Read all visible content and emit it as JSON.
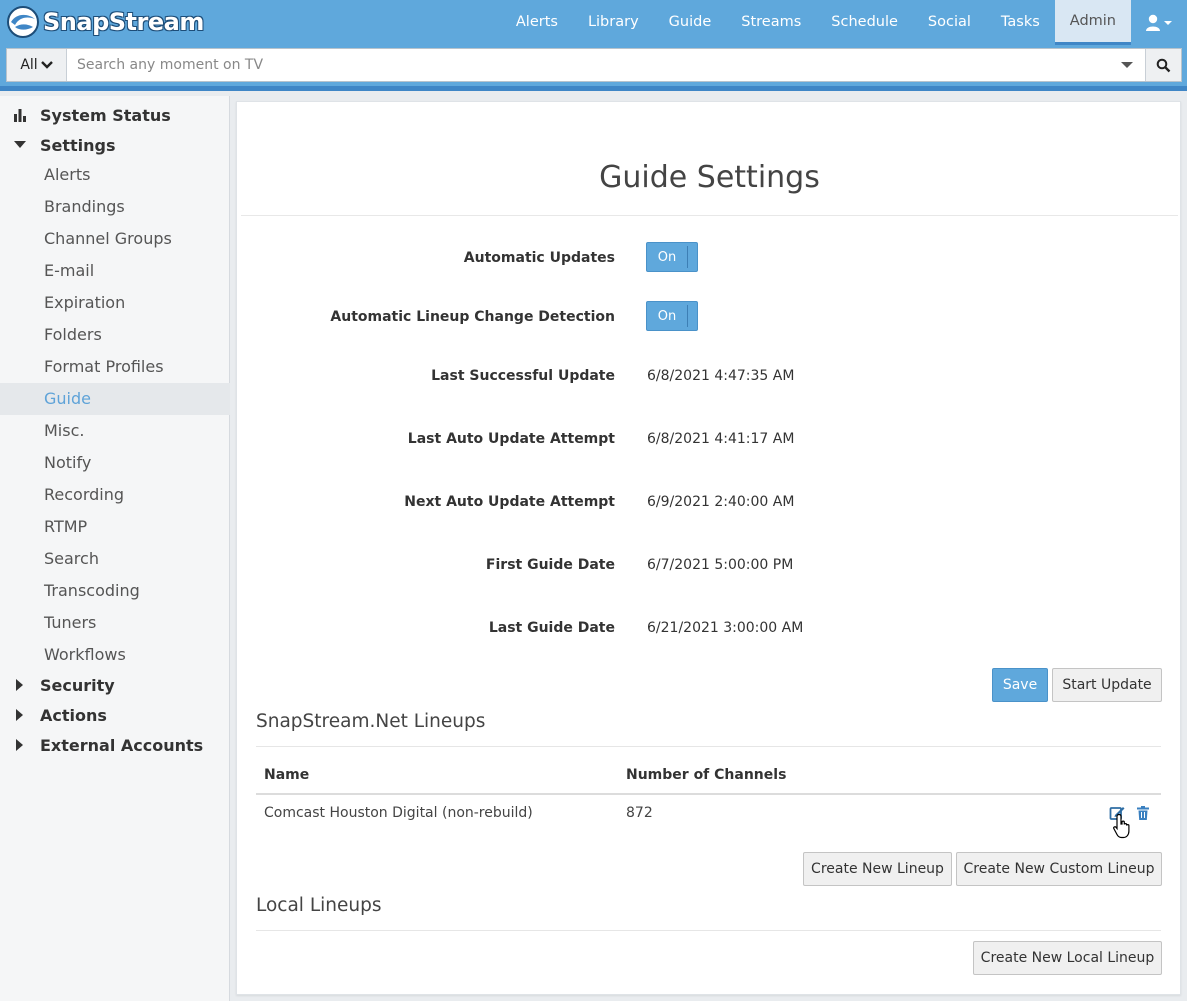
{
  "app": {
    "logo_text": "SnapStream",
    "nav": [
      "Alerts",
      "Library",
      "Guide",
      "Streams",
      "Schedule",
      "Social",
      "Tasks",
      "Admin"
    ],
    "active_nav": "Admin"
  },
  "search": {
    "scope": "All",
    "placeholder": "Search any moment on TV"
  },
  "sidebar": {
    "sections": [
      {
        "label": "System Status",
        "icon": "bar-chart-icon"
      },
      {
        "label": "Settings",
        "icon": "caret-down-icon"
      },
      {
        "label": "Security",
        "icon": "caret-right-icon"
      },
      {
        "label": "Actions",
        "icon": "caret-right-icon"
      },
      {
        "label": "External Accounts",
        "icon": "caret-right-icon"
      }
    ],
    "settings_items": [
      "Alerts",
      "Brandings",
      "Channel Groups",
      "E-mail",
      "Expiration",
      "Folders",
      "Format Profiles",
      "Guide",
      "Misc.",
      "Notify",
      "Recording",
      "RTMP",
      "Search",
      "Transcoding",
      "Tuners",
      "Workflows"
    ],
    "active_item": "Guide"
  },
  "page": {
    "title": "Guide Settings",
    "fields": {
      "automatic_updates": {
        "label": "Automatic Updates",
        "toggle": "On"
      },
      "lineup_detection": {
        "label": "Automatic Lineup Change Detection",
        "toggle": "On"
      },
      "last_success": {
        "label": "Last Successful Update",
        "value": "6/8/2021 4:47:35 AM"
      },
      "last_attempt": {
        "label": "Last Auto Update Attempt",
        "value": "6/8/2021 4:41:17 AM"
      },
      "next_attempt": {
        "label": "Next Auto Update Attempt",
        "value": "6/9/2021 2:40:00 AM"
      },
      "first_date": {
        "label": "First Guide Date",
        "value": "6/7/2021 5:00:00 PM"
      },
      "last_date": {
        "label": "Last Guide Date",
        "value": "6/21/2021 3:00:00 AM"
      }
    },
    "buttons": {
      "save": "Save",
      "start_update": "Start Update"
    }
  },
  "lineups": {
    "title": "SnapStream.Net Lineups",
    "columns": [
      "Name",
      "Number of Channels"
    ],
    "rows": [
      {
        "name": "Comcast Houston Digital (non-rebuild)",
        "channels": "872"
      }
    ],
    "buttons": {
      "create": "Create New Lineup",
      "create_custom": "Create New Custom Lineup"
    }
  },
  "local_lineups": {
    "title": "Local Lineups",
    "buttons": {
      "create_local": "Create New Local Lineup"
    }
  },
  "colors": {
    "accent": "#5fa8dc",
    "accent_dark": "#3f86c6",
    "link_active": "#5fa3d8"
  }
}
